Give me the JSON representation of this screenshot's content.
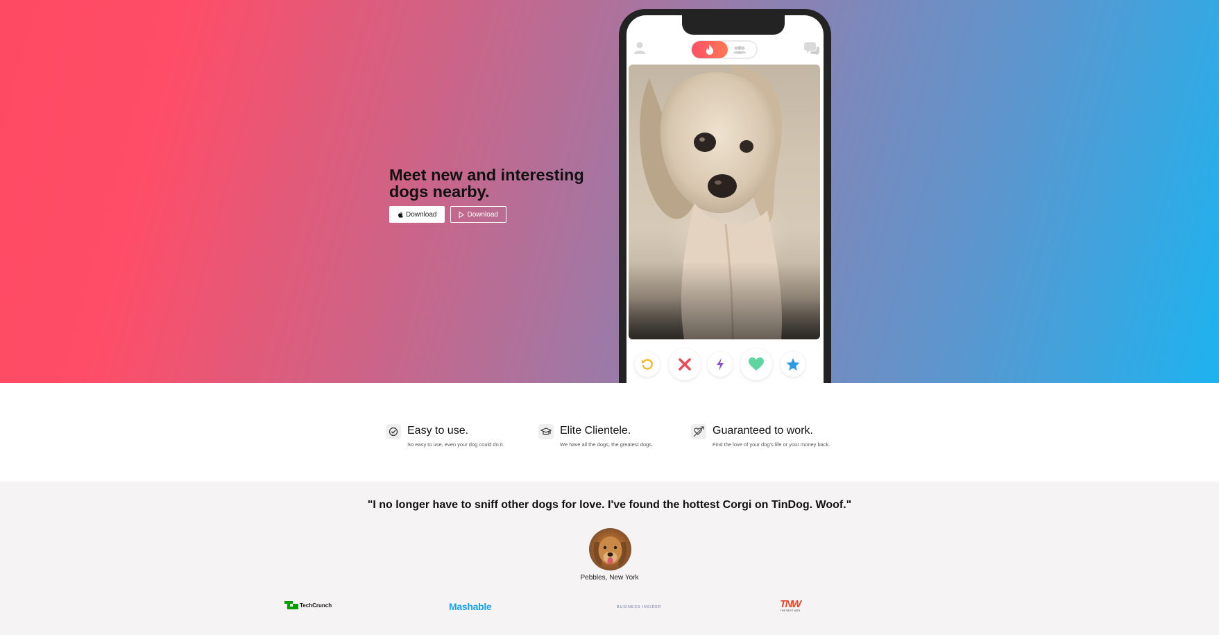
{
  "hero": {
    "title": "Meet new and interesting dogs nearby.",
    "apple_download_label": "Download",
    "google_download_label": "Download"
  },
  "phone": {
    "header_icons": [
      "user-icon",
      "flame-icon",
      "group-icon",
      "chat-icon"
    ],
    "action_buttons": [
      "rewind-icon",
      "nope-icon",
      "boost-icon",
      "like-icon",
      "super-like-icon"
    ]
  },
  "features": [
    {
      "icon": "check-circle-icon",
      "title": "Easy to use.",
      "description": "So easy to use, even your dog could do it."
    },
    {
      "icon": "graduation-cap-icon",
      "title": "Elite Clientele.",
      "description": "We have all the dogs, the greatest dogs."
    },
    {
      "icon": "heart-arrow-icon",
      "title": "Guaranteed to work.",
      "description": "Find the love of your dog's life or your money back."
    }
  ],
  "testimonial": {
    "quote": "\"I no longer have to sniff other dogs for love. I've found the hottest Corgi on TinDog. Woof.\"",
    "person": "Pebbles, New York"
  },
  "press": {
    "techcrunch": "TechCrunch",
    "mashable": "Mashable",
    "business_insider": "BUSINESS INSIDER",
    "tnw": "TNW",
    "tnw_sub": "THE NEXT WEB"
  },
  "colors": {
    "hero_gradient_start": "#ff4a63",
    "hero_gradient_end": "#1db3ef",
    "brand_pink": "#fd5068"
  }
}
